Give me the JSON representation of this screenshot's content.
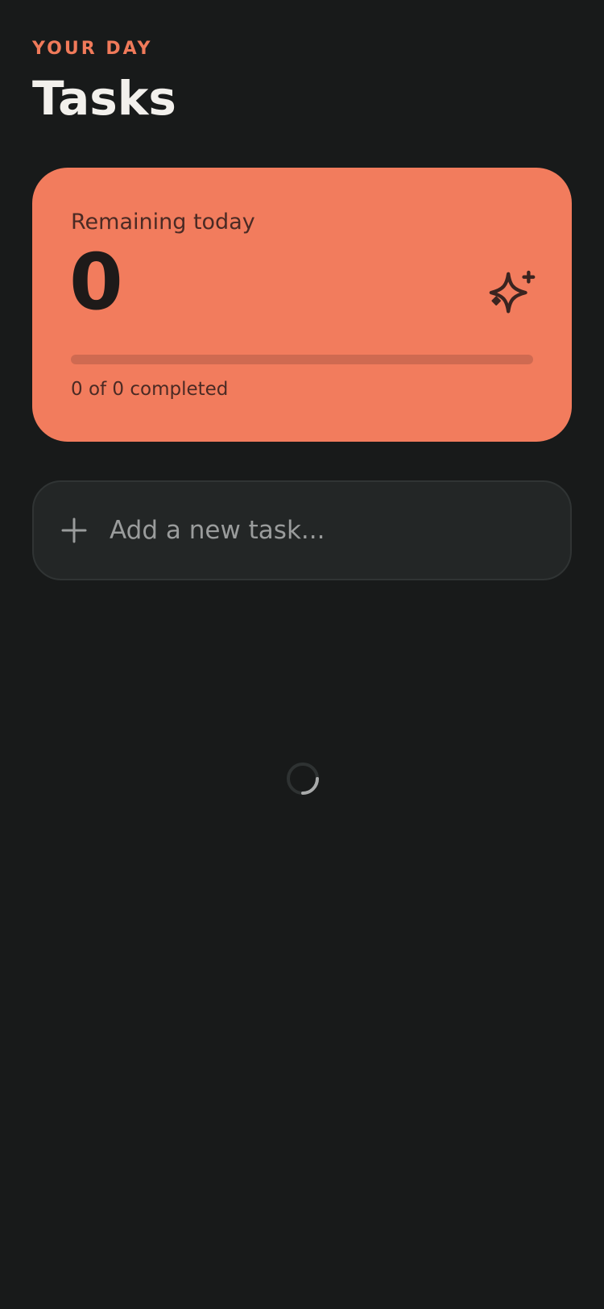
{
  "header": {
    "eyebrow": "YOUR DAY",
    "title": "Tasks"
  },
  "summary": {
    "label": "Remaining today",
    "remaining": "0",
    "progress_text": "0 of 0 completed",
    "progress_fraction": 0,
    "icon": "sparkle-icon"
  },
  "add_task": {
    "icon": "plus-icon",
    "placeholder": "Add a new task..."
  },
  "loading": {
    "icon": "loading-spinner"
  },
  "colors": {
    "background": "#181a1a",
    "accent": "#f27c5d",
    "eyebrow": "#f07a5a",
    "input_background": "#232626"
  }
}
